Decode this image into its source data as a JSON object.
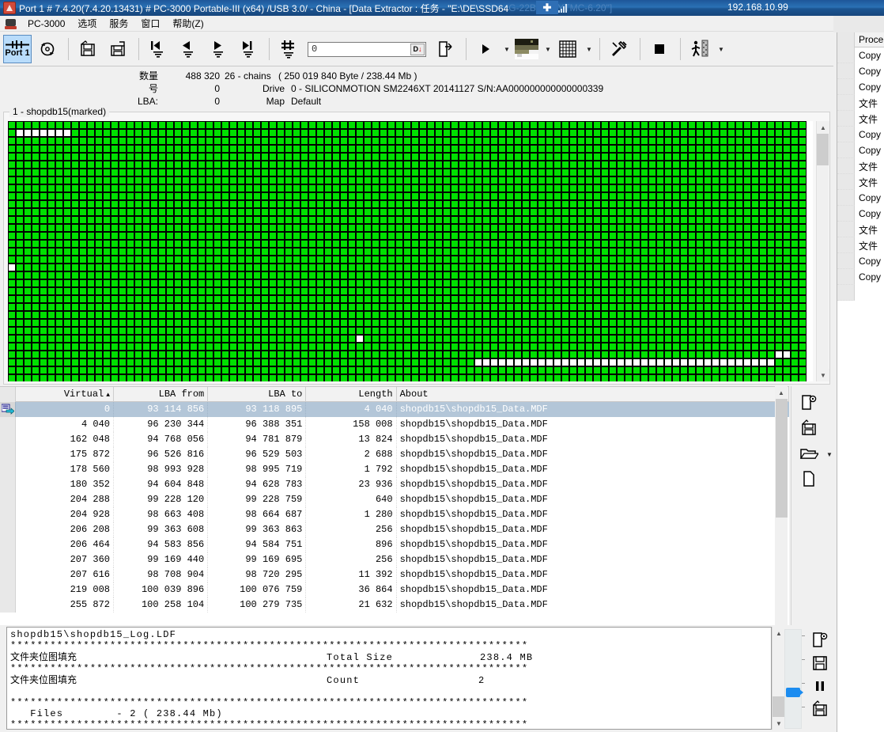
{
  "titlebar": {
    "text_main": "Port 1 # 7.4.20(7.4.20.13431) # PC-3000 Portable-III (x64) /USB 3.0/ - China - [Data Extractor : 任务 - \"E:\\DE\\SSD64",
    "text_dim": "G-22B8XD-YTMC-6.20\"]",
    "ip": "192.168.10.99",
    "tray_badge": "✣",
    "app_icon": "pc3000-icon"
  },
  "menubar": {
    "items": [
      {
        "label": "PC-3000"
      },
      {
        "label": "选项"
      },
      {
        "label": "服务"
      },
      {
        "label": "窗口"
      },
      {
        "label": "帮助(Z)"
      }
    ]
  },
  "toolbar": {
    "port_label": "Port 1",
    "address_value": "0",
    "address_placeholder": "0",
    "address_button_label": "D",
    "address_button_arrow": "↓",
    "items": [
      {
        "name": "port1-button",
        "label": "Port 1"
      },
      {
        "name": "refresh-task-button",
        "label": ""
      },
      {
        "name": "save-task-button",
        "label": ""
      },
      {
        "name": "save-as-task-button",
        "label": ""
      },
      {
        "name": "first-record-button",
        "label": ""
      },
      {
        "name": "prev-record-button",
        "label": ""
      },
      {
        "name": "next-record-button",
        "label": ""
      },
      {
        "name": "last-record-button",
        "label": ""
      },
      {
        "name": "goto-number-button",
        "label": ""
      },
      {
        "name": "export-button",
        "label": ""
      },
      {
        "name": "run-button",
        "label": ""
      },
      {
        "name": "map-view-button",
        "label": ""
      },
      {
        "name": "grid-view-button",
        "label": ""
      },
      {
        "name": "tools-button",
        "label": ""
      },
      {
        "name": "stop-button",
        "label": ""
      },
      {
        "name": "walk-mode-button",
        "label": ""
      }
    ]
  },
  "info": {
    "count_label": "数量",
    "count_value": "488 320",
    "chains_text": "26 - chains",
    "size_text": "( 250 019 840 Byte /  238.44 Mb )",
    "number_label": "号",
    "number_value": "0",
    "lba_label": "LBA:",
    "lba_value": "0",
    "drive_label": "Drive",
    "drive_value": "0 - SILICONMOTION SM2246XT 20141127 S/N:AA000000000000000339",
    "map_label": "Map",
    "map_value": "Default"
  },
  "map": {
    "legend": "1 - shopdb15(marked)",
    "cell_color_used": "#00e000",
    "cell_color_free": "#ffffff",
    "cols": 101,
    "rows": 33,
    "free_cells": [
      {
        "row": 1,
        "from": 1,
        "to": 7
      },
      {
        "row": 18,
        "from": 0,
        "to": 0
      },
      {
        "row": 27,
        "from": 44,
        "to": 44
      },
      {
        "row": 29,
        "from": 97,
        "to": 98
      },
      {
        "row": 30,
        "from": 59,
        "to": 96
      }
    ]
  },
  "table": {
    "columns": [
      {
        "key": "virtual",
        "label": "Virtual",
        "sorted": true,
        "sort_arrow": "▲"
      },
      {
        "key": "lba_from",
        "label": "LBA from"
      },
      {
        "key": "lba_to",
        "label": "LBA to"
      },
      {
        "key": "length",
        "label": "Length"
      },
      {
        "key": "about",
        "label": "About"
      }
    ],
    "rows": [
      {
        "virtual": "0",
        "lba_from": "93 114 856",
        "lba_to": "93 118 895",
        "length": "4 040",
        "about": "shopdb15\\shopdb15_Data.MDF",
        "selected": true
      },
      {
        "virtual": "4 040",
        "lba_from": "96 230 344",
        "lba_to": "96 388 351",
        "length": "158 008",
        "about": "shopdb15\\shopdb15_Data.MDF",
        "selected": false
      },
      {
        "virtual": "162 048",
        "lba_from": "94 768 056",
        "lba_to": "94 781 879",
        "length": "13 824",
        "about": "shopdb15\\shopdb15_Data.MDF",
        "selected": false
      },
      {
        "virtual": "175 872",
        "lba_from": "96 526 816",
        "lba_to": "96 529 503",
        "length": "2 688",
        "about": "shopdb15\\shopdb15_Data.MDF",
        "selected": false
      },
      {
        "virtual": "178 560",
        "lba_from": "98 993 928",
        "lba_to": "98 995 719",
        "length": "1 792",
        "about": "shopdb15\\shopdb15_Data.MDF",
        "selected": false
      },
      {
        "virtual": "180 352",
        "lba_from": "94 604 848",
        "lba_to": "94 628 783",
        "length": "23 936",
        "about": "shopdb15\\shopdb15_Data.MDF",
        "selected": false
      },
      {
        "virtual": "204 288",
        "lba_from": "99 228 120",
        "lba_to": "99 228 759",
        "length": "640",
        "about": "shopdb15\\shopdb15_Data.MDF",
        "selected": false
      },
      {
        "virtual": "204 928",
        "lba_from": "98 663 408",
        "lba_to": "98 664 687",
        "length": "1 280",
        "about": "shopdb15\\shopdb15_Data.MDF",
        "selected": false
      },
      {
        "virtual": "206 208",
        "lba_from": "99 363 608",
        "lba_to": "99 363 863",
        "length": "256",
        "about": "shopdb15\\shopdb15_Data.MDF",
        "selected": false
      },
      {
        "virtual": "206 464",
        "lba_from": "94 583 856",
        "lba_to": "94 584 751",
        "length": "896",
        "about": "shopdb15\\shopdb15_Data.MDF",
        "selected": false
      },
      {
        "virtual": "207 360",
        "lba_from": "99 169 440",
        "lba_to": "99 169 695",
        "length": "256",
        "about": "shopdb15\\shopdb15_Data.MDF",
        "selected": false
      },
      {
        "virtual": "207 616",
        "lba_from": "98 708 904",
        "lba_to": "98 720 295",
        "length": "11 392",
        "about": "shopdb15\\shopdb15_Data.MDF",
        "selected": false
      },
      {
        "virtual": "219 008",
        "lba_from": "100 039 896",
        "lba_to": "100 076 759",
        "length": "36 864",
        "about": "shopdb15\\shopdb15_Data.MDF",
        "selected": false
      },
      {
        "virtual": "255 872",
        "lba_from": "100 258 104",
        "lba_to": "100 279 735",
        "length": "21 632",
        "about": "shopdb15\\shopdb15_Data.MDF",
        "selected": false
      }
    ]
  },
  "table_tools": [
    {
      "name": "extract-task-button"
    },
    {
      "name": "save-map-button"
    },
    {
      "name": "open-folder-button"
    },
    {
      "name": "new-file-button"
    }
  ],
  "log": {
    "lines": [
      {
        "type": "mono",
        "text": "shopdb15\\shopdb15_Log.LDF"
      },
      {
        "type": "stars",
        "text": "*************************************************************************"
      },
      {
        "type": "cnrow",
        "cn": "文件夹位图填充",
        "key": "Total Size",
        "value": "238.4 MB"
      },
      {
        "type": "stars",
        "text": "*************************************************************************"
      },
      {
        "type": "cnrow",
        "cn": "文件夹位图填充",
        "key": "Count",
        "value": "2"
      },
      {
        "type": "blank",
        "text": ""
      },
      {
        "type": "stars",
        "text": "*************************************************************************"
      },
      {
        "type": "mono",
        "text": "   Files        - 2 ( 238.44 Mb)"
      },
      {
        "type": "stars",
        "text": "*************************************************************************"
      }
    ]
  },
  "log_tools": [
    {
      "name": "extract-log-button"
    },
    {
      "name": "save-log-button"
    },
    {
      "name": "pause-button"
    },
    {
      "name": "save-as-log-button"
    }
  ],
  "right_panel": {
    "header": "Proce",
    "rows": [
      {
        "label": "Copy"
      },
      {
        "label": "Copy"
      },
      {
        "label": "Copy"
      },
      {
        "label": "文件"
      },
      {
        "label": "文件"
      },
      {
        "label": "Copy"
      },
      {
        "label": "Copy"
      },
      {
        "label": "文件"
      },
      {
        "label": "文件"
      },
      {
        "label": "Copy"
      },
      {
        "label": "Copy"
      },
      {
        "label": "文件"
      },
      {
        "label": "文件"
      },
      {
        "label": "Copy"
      },
      {
        "label": "Copy"
      }
    ]
  }
}
